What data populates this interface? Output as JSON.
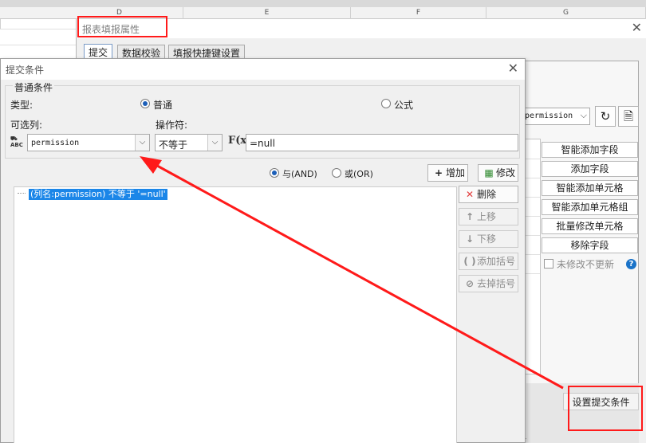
{
  "sheet": {
    "columns": [
      "D",
      "E",
      "F",
      "G"
    ]
  },
  "outer_dialog": {
    "title": "报表填报属性",
    "tabs": [
      "提交",
      "数据校验",
      "填报快捷键设置"
    ],
    "field_select_value": "permission",
    "side_buttons": [
      "智能添加字段",
      "添加字段",
      "智能添加单元格",
      "智能添加单元格组",
      "批量修改单元格",
      "移除字段"
    ],
    "unmodified_checkbox_label": "未修改不更新",
    "submit_condition_button": "设置提交条件"
  },
  "inner_dialog": {
    "title": "提交条件",
    "group_label": "普通条件",
    "type_label": "类型:",
    "type_options": [
      "普通",
      "公式"
    ],
    "type_selected": "普通",
    "column_label": "可选列:",
    "operator_label": "操作符:",
    "column_value": "permission",
    "operator_value": "不等于",
    "fx_label": "F(x)",
    "value_input": "=null",
    "logic_options": [
      "与(AND)",
      "或(OR)"
    ],
    "logic_selected": "与(AND)",
    "add_button": "增加",
    "modify_button": "修改",
    "side_buttons": [
      "删除",
      "上移",
      "下移",
      "添加括号",
      "去掉括号"
    ],
    "conditions": [
      "(列名:permission) 不等于 '=null'"
    ]
  },
  "colors": {
    "annotation_red": "#ff1a1a",
    "selection_blue": "#1b86e8"
  }
}
